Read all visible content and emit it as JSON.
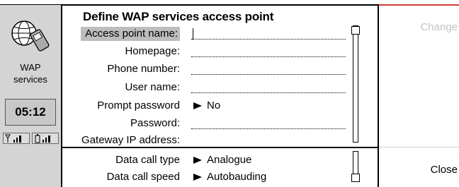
{
  "app": {
    "name_line1": "WAP",
    "name_line2": "services",
    "clock": "05:12"
  },
  "dialog": {
    "title": "Define WAP services access point",
    "fields": [
      {
        "label": "Access point name:",
        "value": ""
      },
      {
        "label": "Homepage:",
        "value": ""
      },
      {
        "label": "Phone number:",
        "value": ""
      },
      {
        "label": "User name:",
        "value": ""
      },
      {
        "label": "Prompt password",
        "value": "No"
      },
      {
        "label": "Password:",
        "value": ""
      },
      {
        "label": "Gateway IP address:",
        "value": ""
      }
    ],
    "bottom_fields": [
      {
        "label": "Data call type",
        "value": "Analogue"
      },
      {
        "label": "Data call speed",
        "value": "Autobauding"
      }
    ]
  },
  "softkeys": {
    "change": "Change",
    "close": "Close"
  },
  "icons": [
    "globe-phone-icon",
    "signal-icon",
    "battery-icon",
    "selection-arrow-icon"
  ]
}
